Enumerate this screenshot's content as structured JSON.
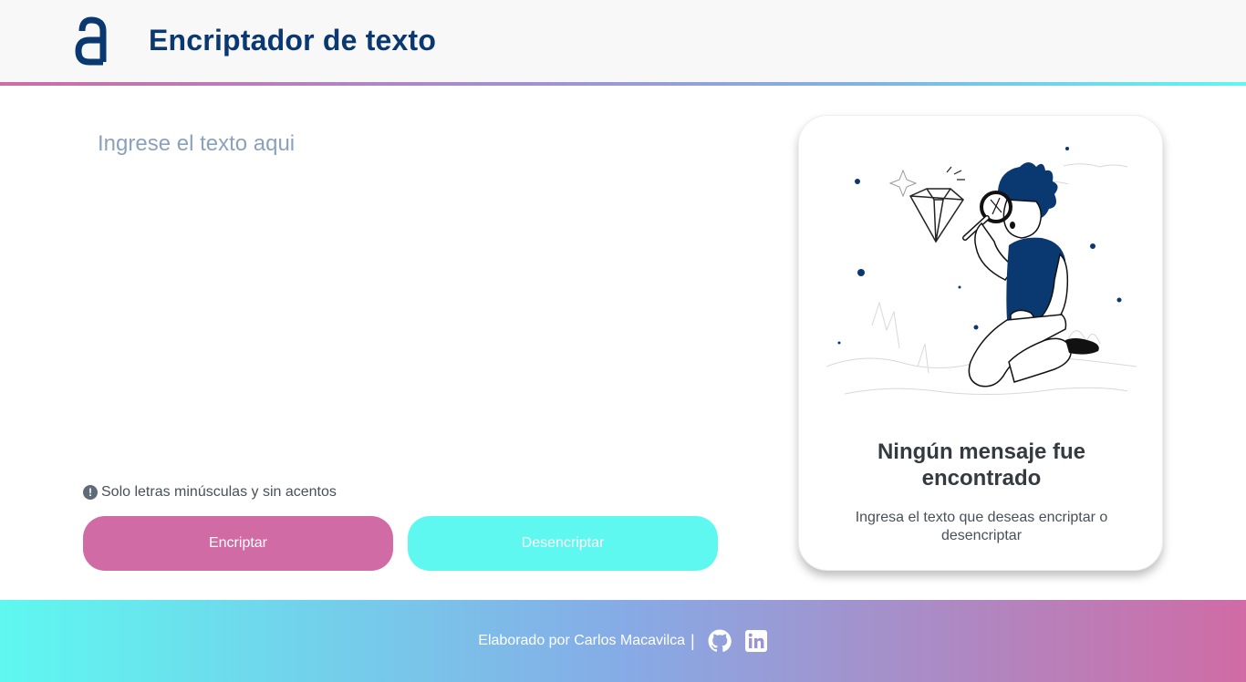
{
  "header": {
    "logo_icon": "alura-a-logo-icon",
    "title": "Encriptador de texto"
  },
  "input": {
    "placeholder": "Ingrese el texto aqui",
    "value": ""
  },
  "hint": {
    "icon": "exclamation-circle-icon",
    "text": "Solo letras minúsculas y sin acentos"
  },
  "buttons": {
    "encrypt_label": "Encriptar",
    "decrypt_label": "Desencriptar"
  },
  "result_card": {
    "illustration": "person-with-magnifying-glass-illustration",
    "title": "Ningún mensaje fue encontrado",
    "text": "Ingresa el texto que deseas encriptar o desencriptar"
  },
  "footer": {
    "credit": "Elaborado por Carlos Macavilca",
    "separator": "|",
    "icons": [
      "github-icon",
      "linkedin-icon"
    ]
  },
  "colors": {
    "brand_dark_blue": "#0a3871",
    "encrypt_pink": "#d06ba5",
    "decrypt_cyan": "#5ef8f0",
    "placeholder_blue": "#8aa2bd"
  }
}
